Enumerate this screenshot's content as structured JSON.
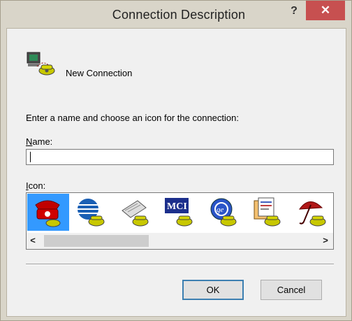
{
  "window": {
    "title": "Connection Description",
    "help_glyph": "?",
    "close_glyph": "✕",
    "close_color": "#c75050"
  },
  "header": {
    "icon": "telephone-terminal-icon",
    "connection_name": "New Connection"
  },
  "form": {
    "instruction": "Enter a name and choose an icon for the connection:",
    "name_label": "Name:",
    "name_value": "",
    "icon_label": "Icon:"
  },
  "icon_list": {
    "items": [
      {
        "name": "red-telephone-icon",
        "selected": true
      },
      {
        "name": "blue-globe-telephone-icon",
        "selected": false
      },
      {
        "name": "fax-telephone-icon",
        "selected": false
      },
      {
        "name": "mci-telephone-icon",
        "selected": false
      },
      {
        "name": "ge-globe-telephone-icon",
        "selected": false
      },
      {
        "name": "documents-telephone-icon",
        "selected": false
      },
      {
        "name": "umbrella-telephone-icon",
        "selected": false
      }
    ],
    "selection_color": "#3399ff",
    "scroll_left": "<",
    "scroll_right": ">"
  },
  "buttons": {
    "ok": "OK",
    "cancel": "Cancel"
  }
}
